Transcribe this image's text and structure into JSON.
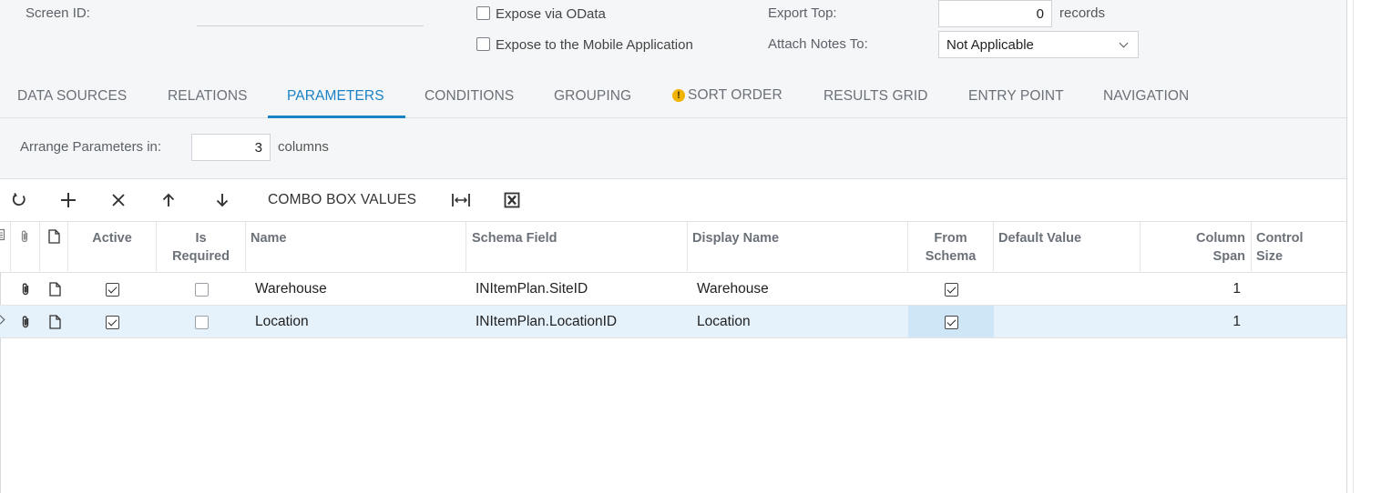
{
  "form": {
    "screen_id_label": "Screen ID:",
    "expose_odata_label": "Expose via OData",
    "expose_mobile_label": "Expose to the Mobile Application",
    "export_top_label": "Export Top:",
    "export_top_value": "0",
    "records_label": "records",
    "attach_notes_label": "Attach Notes To:",
    "attach_notes_value": "Not Applicable"
  },
  "tabs": [
    {
      "label": "DATA SOURCES"
    },
    {
      "label": "RELATIONS"
    },
    {
      "label": "PARAMETERS",
      "active": true
    },
    {
      "label": "CONDITIONS"
    },
    {
      "label": "GROUPING"
    },
    {
      "label": "SORT ORDER",
      "warning": true
    },
    {
      "label": "RESULTS GRID"
    },
    {
      "label": "ENTRY POINT"
    },
    {
      "label": "NAVIGATION"
    }
  ],
  "arrange": {
    "label": "Arrange Parameters in:",
    "value": "3",
    "suffix": "columns"
  },
  "toolbar": {
    "combo_box_values": "COMBO BOX VALUES",
    "icons": [
      "refresh-icon",
      "add-icon",
      "delete-icon",
      "move-up-icon",
      "move-down-icon",
      "fit-columns-icon",
      "export-excel-icon"
    ]
  },
  "grid": {
    "columns": {
      "active": "Active",
      "is_required_1": "Is",
      "is_required_2": "Required",
      "name": "Name",
      "schema_field": "Schema Field",
      "display_name": "Display Name",
      "from_schema_1": "From",
      "from_schema_2": "Schema",
      "default_value": "Default Value",
      "column_span_1": "Column",
      "column_span_2": "Span",
      "control_size_1": "Control",
      "control_size_2": "Size"
    },
    "rows": [
      {
        "active": true,
        "is_required": false,
        "name": "Warehouse",
        "schema_field": "INItemPlan.SiteID",
        "display_name": "Warehouse",
        "from_schema": true,
        "default_value": "",
        "column_span": "1",
        "control_size": ""
      },
      {
        "active": true,
        "is_required": false,
        "name": "Location",
        "schema_field": "INItemPlan.LocationID",
        "display_name": "Location",
        "from_schema": true,
        "default_value": "",
        "column_span": "1",
        "control_size": "",
        "selected": true
      }
    ]
  },
  "colors": {
    "accent": "#1b82c5",
    "selected_row": "#e6f2fb",
    "warning": "#f0b400"
  }
}
